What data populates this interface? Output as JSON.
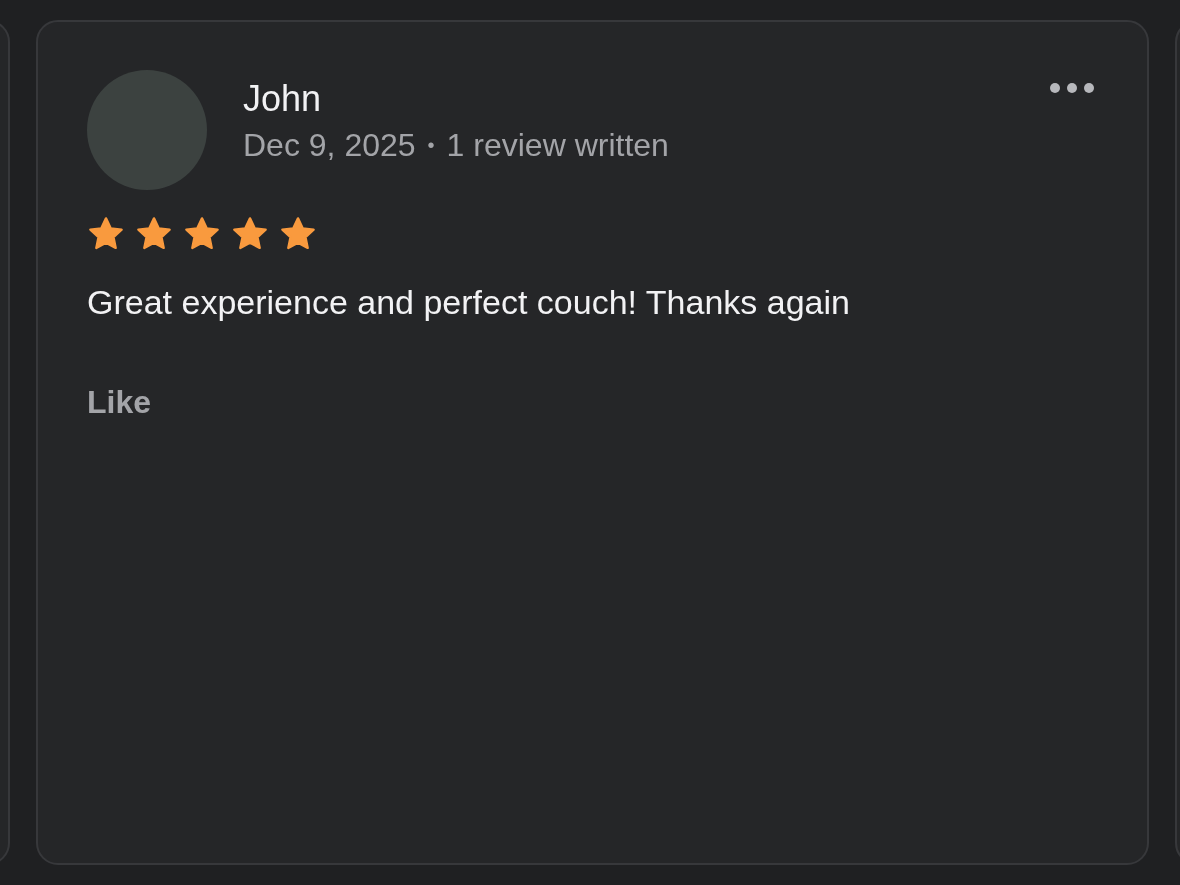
{
  "review": {
    "reviewer": "John",
    "date": "Dec 9, 2025",
    "separator": "•",
    "review_count": "1 review written",
    "stars": 5,
    "text": "Great experience and perfect couch! Thanks again",
    "like": "Like"
  }
}
